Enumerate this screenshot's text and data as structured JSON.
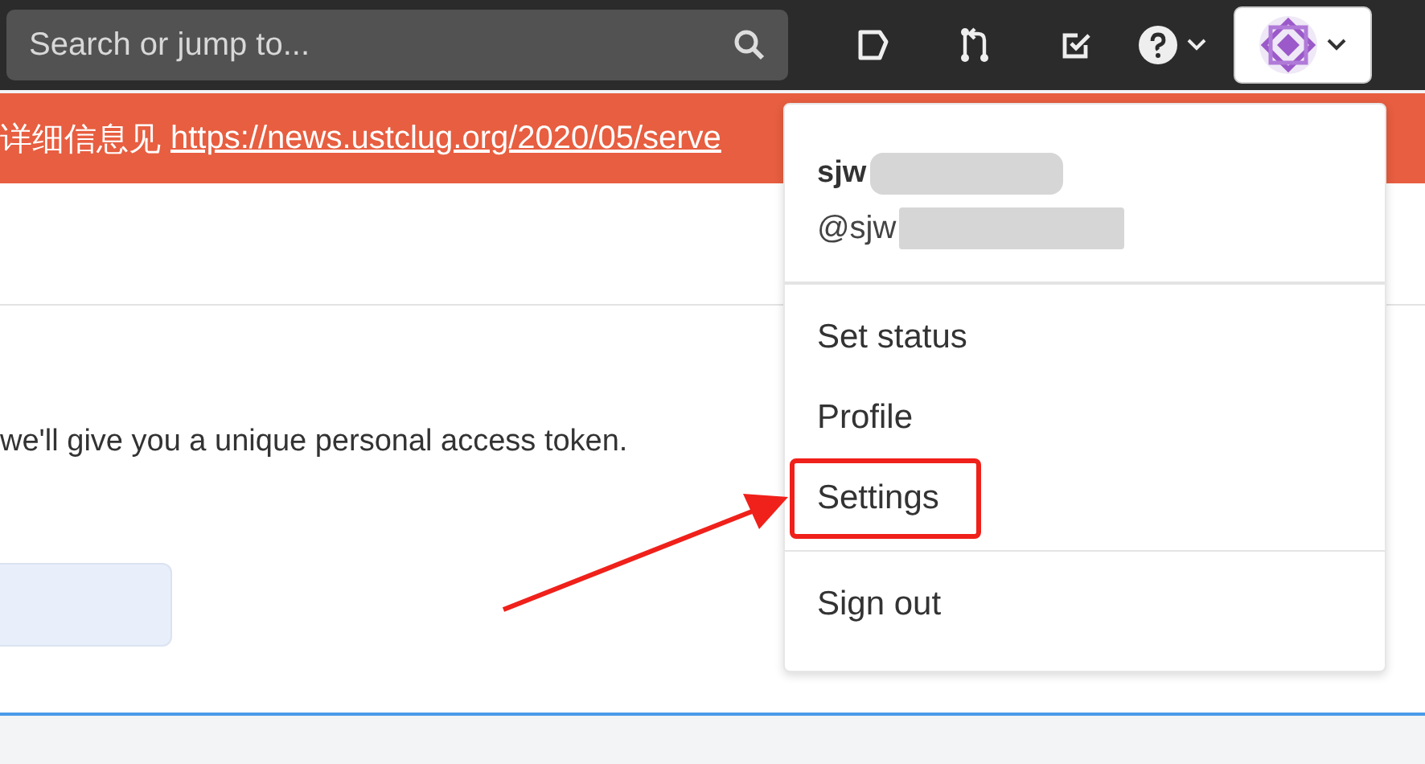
{
  "header": {
    "search": {
      "placeholder": "Search or jump to..."
    }
  },
  "banner": {
    "text": "详细信息见",
    "link": "https://news.ustclug.org/2020/05/serve"
  },
  "content": {
    "text": "we'll give you a unique personal access token."
  },
  "user_menu": {
    "expanded": true,
    "name": "sjw",
    "handle": "@sjw",
    "items": [
      {
        "label": "Set status",
        "highlighted": false
      },
      {
        "label": "Profile",
        "highlighted": false
      },
      {
        "label": "Settings",
        "highlighted": true
      },
      {
        "label": "Sign out",
        "highlighted": false
      }
    ]
  }
}
